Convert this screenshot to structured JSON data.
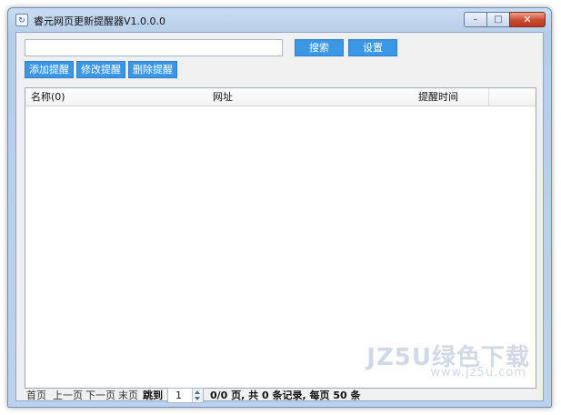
{
  "window": {
    "title": "睿元网页更新提醒器V1.0.0.0",
    "controls": {
      "minimize_glyph": "–",
      "maximize_glyph": "□",
      "close_glyph": "✕"
    }
  },
  "toolbar": {
    "search_value": "",
    "search_button": "搜索",
    "settings_button": "设置",
    "add_button": "添加提醒",
    "edit_button": "修改提醒",
    "delete_button": "删除提醒"
  },
  "grid": {
    "columns": [
      "名称(0)",
      "网址",
      "提醒时间"
    ],
    "rows": []
  },
  "pager": {
    "first": "首页",
    "prev": "上一页",
    "next": "下一页",
    "last": "末页",
    "jump_label": "跳到",
    "page_value": "1",
    "summary": "0/0 页, 共 0 条记录, 每页 50 条"
  },
  "watermark": {
    "logo": "JZ5U绿色下载",
    "url": "www.jz5u.com"
  },
  "colors": {
    "accent_button": "#3b97e3",
    "title_bar": "#c9dcf3",
    "close_button": "#c94a2e"
  },
  "icons": [
    "app-icon",
    "minimize-icon",
    "maximize-icon",
    "close-icon",
    "spin-up-icon",
    "spin-down-icon"
  ]
}
